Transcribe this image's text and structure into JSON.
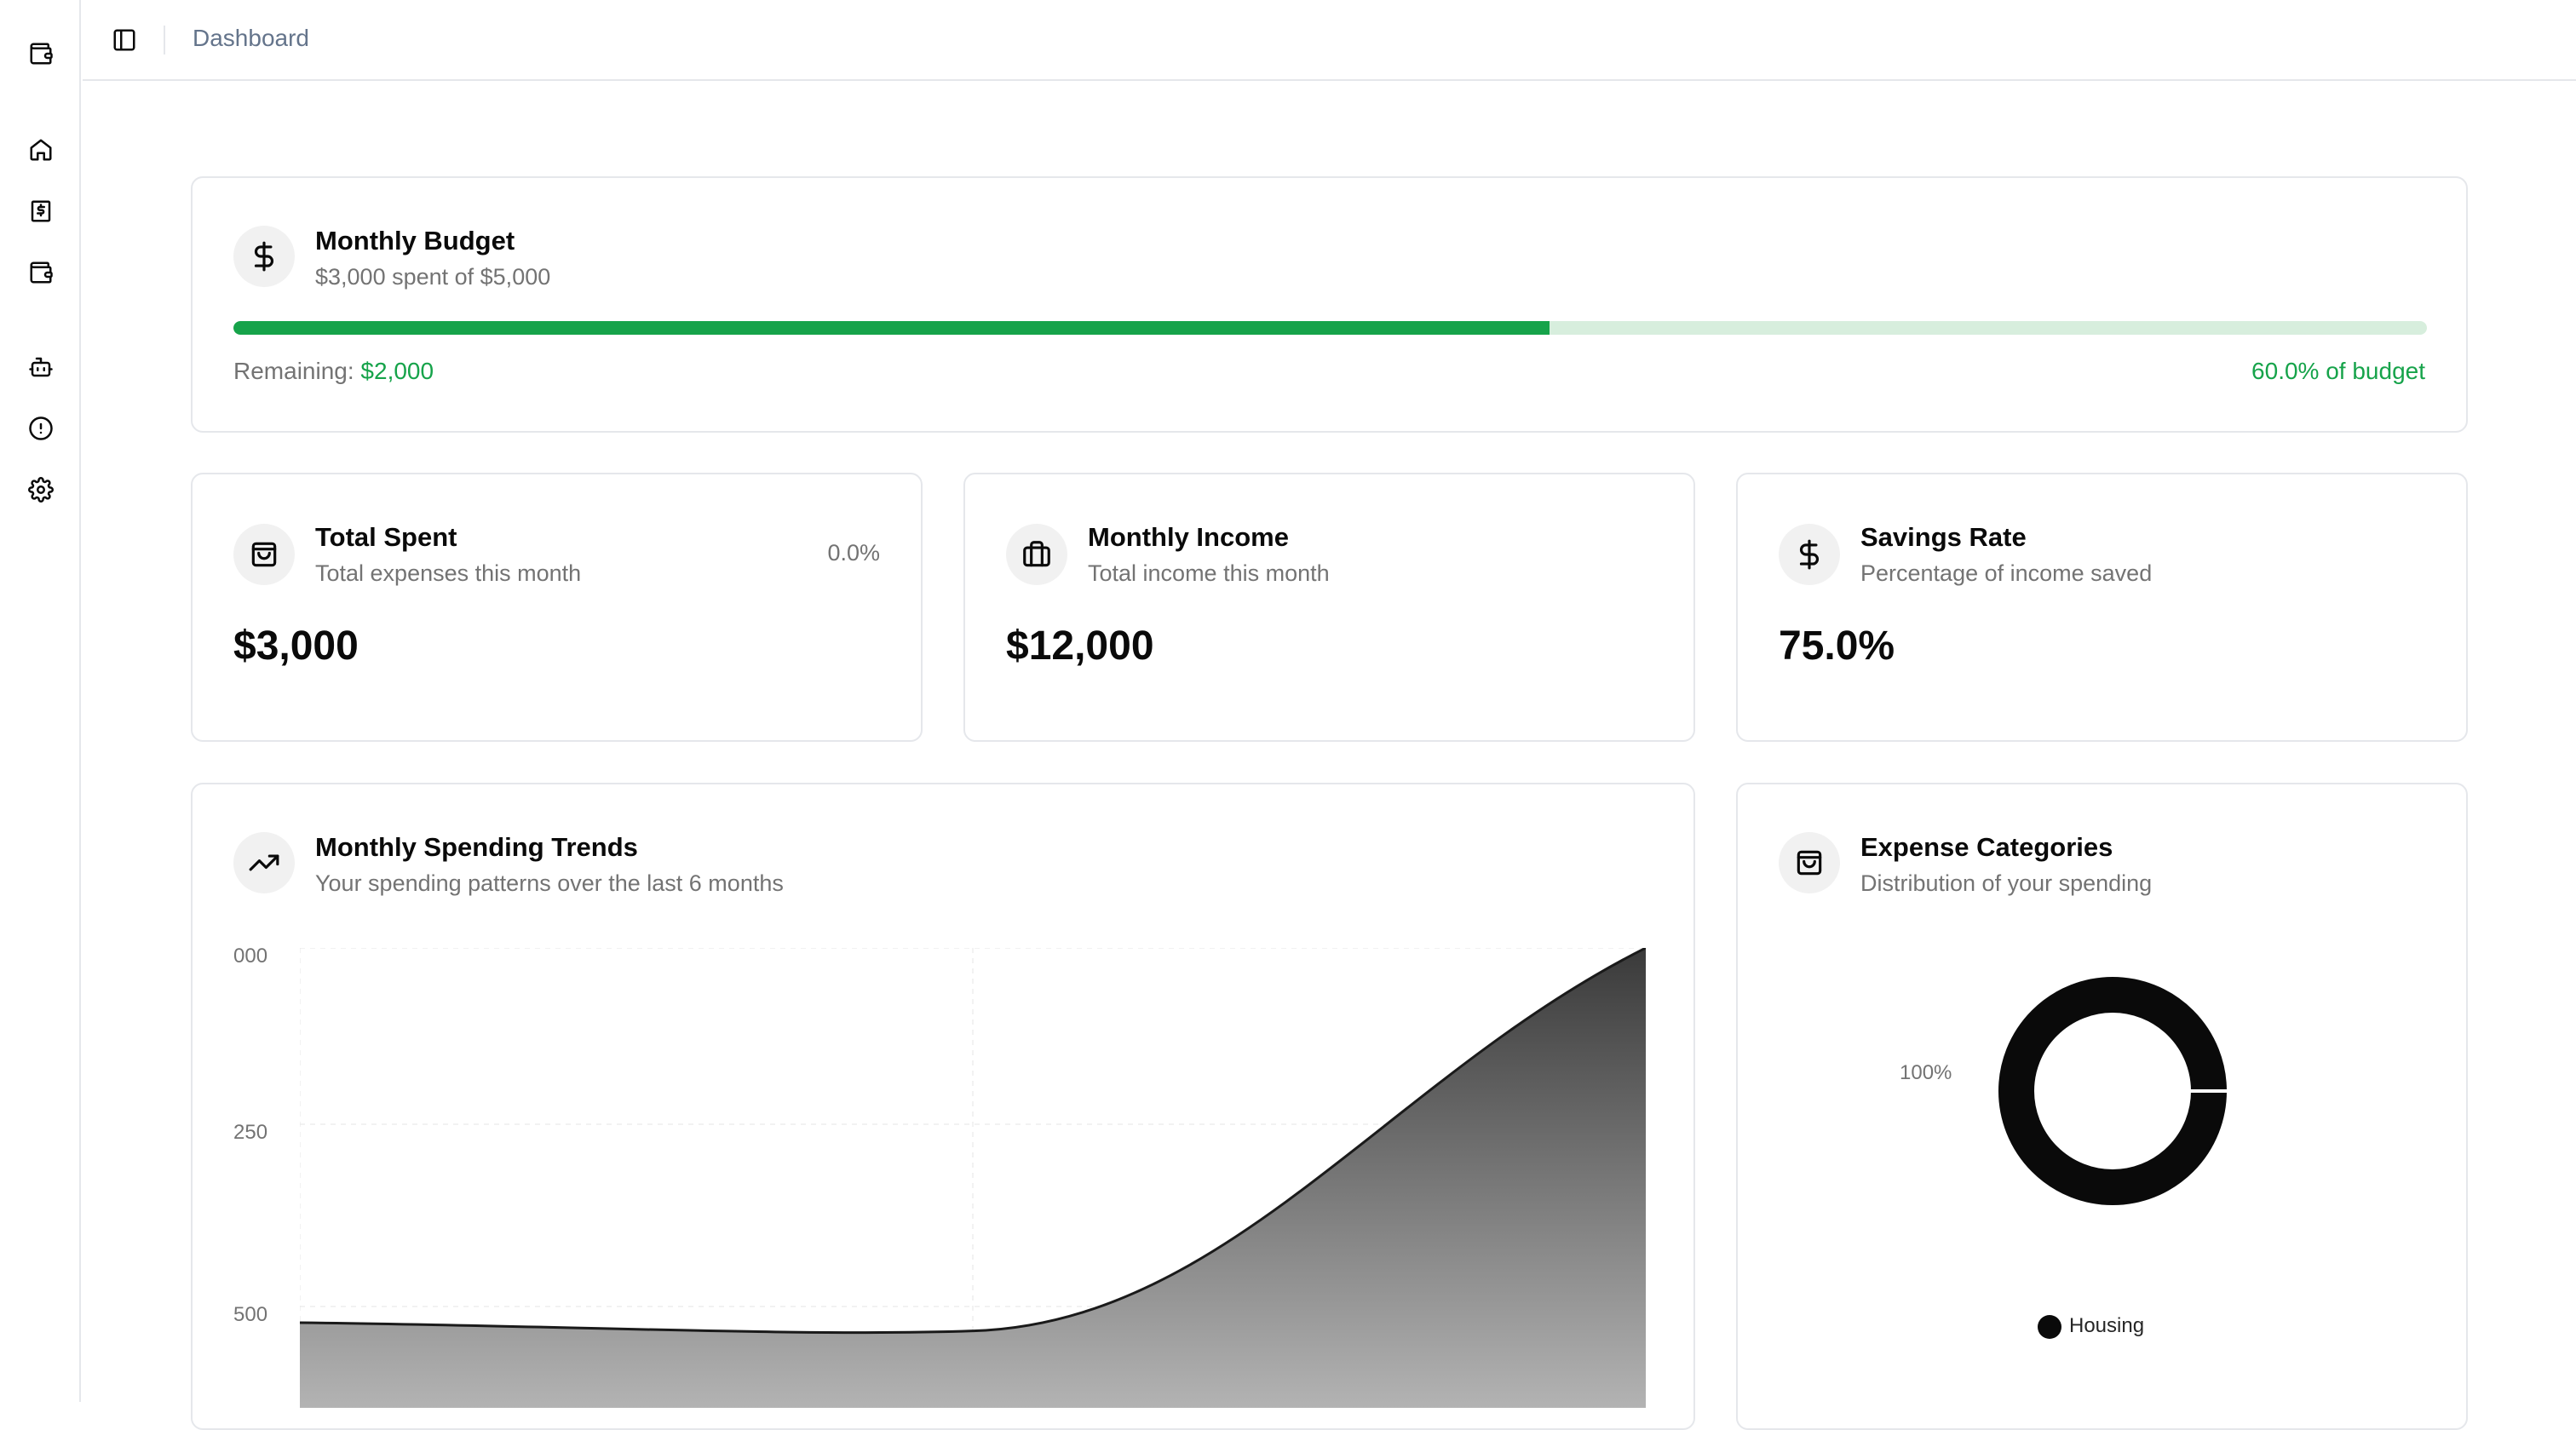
{
  "header": {
    "breadcrumb": "Dashboard"
  },
  "sidebar": {
    "items": [
      {
        "icon": "wallet-icon"
      },
      {
        "icon": "home-icon"
      },
      {
        "icon": "receipt-dollar-icon"
      },
      {
        "icon": "wallet-icon"
      },
      {
        "icon": "bot-icon"
      },
      {
        "icon": "alert-circle-icon"
      },
      {
        "icon": "gear-icon"
      }
    ]
  },
  "budget": {
    "title": "Monthly Budget",
    "subtitle": "$3,000 spent of $5,000",
    "remaining_label": "Remaining:",
    "remaining_value": "$2,000",
    "percent_label": "60.0% of budget",
    "progress": 0.6,
    "colors": {
      "fill": "#16a34a",
      "track": "#d7eedd"
    }
  },
  "stats": [
    {
      "title": "Total Spent",
      "subtitle": "Total expenses this month",
      "value": "$3,000",
      "change": "0.0%",
      "icon": "shopping-bag-icon"
    },
    {
      "title": "Monthly Income",
      "subtitle": "Total income this month",
      "value": "$12,000",
      "icon": "briefcase-icon"
    },
    {
      "title": "Savings Rate",
      "subtitle": "Percentage of income saved",
      "value": "75.0%",
      "icon": "dollar-icon"
    }
  ],
  "trends": {
    "title": "Monthly Spending Trends",
    "subtitle": "Your spending patterns over the last 6 months",
    "icon": "trending-up-icon"
  },
  "categories": {
    "title": "Expense Categories",
    "subtitle": "Distribution of your spending",
    "icon": "shopping-bag-icon",
    "donut_label": "100%",
    "legend": [
      {
        "name": "Housing",
        "color": "#0a0a0a"
      }
    ]
  },
  "chart_data": [
    {
      "type": "area",
      "title": "Monthly Spending Trends",
      "y_ticks": [
        "000",
        "250",
        "500"
      ],
      "points": [
        {
          "x": 0,
          "y": 1350
        },
        {
          "x": 1,
          "y": 1310
        },
        {
          "x": 2,
          "y": 3000
        }
      ],
      "ylim": [
        0,
        3000
      ]
    },
    {
      "type": "pie",
      "title": "Expense Categories",
      "slices": [
        {
          "name": "Housing",
          "value": 100
        }
      ],
      "labels": [
        "100%"
      ]
    }
  ]
}
